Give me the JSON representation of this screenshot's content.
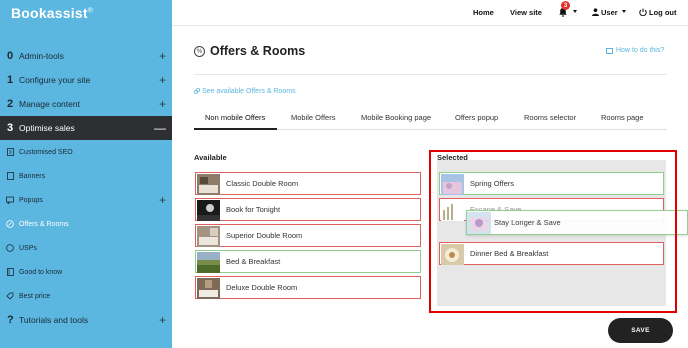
{
  "sidebar": {
    "logo": "Bookassist",
    "logo_mark": "®",
    "items": [
      {
        "num": "0",
        "label": "Admin-tools",
        "toggle": "+"
      },
      {
        "num": "1",
        "label": "Configure your site",
        "toggle": "+"
      },
      {
        "num": "2",
        "label": "Manage content",
        "toggle": "+"
      },
      {
        "num": "3",
        "label": "Optimise sales",
        "toggle": "—"
      }
    ],
    "subitems": [
      {
        "label": "Customised SEO",
        "icon": "document-icon"
      },
      {
        "label": "Banners",
        "icon": "banner-icon"
      },
      {
        "label": "Popups",
        "icon": "popup-icon",
        "toggle": "+"
      },
      {
        "label": "Offers & Rooms",
        "icon": "percent-icon"
      },
      {
        "label": "USPs",
        "icon": "usp-icon"
      },
      {
        "label": "Good to know",
        "icon": "book-icon"
      },
      {
        "label": "Best price",
        "icon": "price-icon"
      }
    ],
    "last_item": {
      "num": "?",
      "label": "Tutorials and tools",
      "toggle": "+"
    }
  },
  "topbar": {
    "home": "Home",
    "view_site": "View site",
    "notifications": "3",
    "user": "User",
    "logout": "Log out"
  },
  "page": {
    "title": "Offers & Rooms",
    "howto": "How to do this?",
    "see_link": "See available Offers & Rooms"
  },
  "tabs": [
    "Non mobile Offers",
    "Mobile Offers",
    "Mobile Booking page",
    "Offers popup",
    "Rooms selector",
    "Rooms page"
  ],
  "available_label": "Available",
  "selected_label": "Selected",
  "available": [
    {
      "name": "Classic Double Room",
      "state": "red"
    },
    {
      "name": "Book for Tonight",
      "state": "red"
    },
    {
      "name": "Superior Double Room",
      "state": "red"
    },
    {
      "name": "Bed & Breakfast",
      "state": "green"
    },
    {
      "name": "Deluxe Double Room",
      "state": "red"
    }
  ],
  "selected": [
    {
      "name": "Spring Offers",
      "state": "green"
    },
    {
      "name": "Dinner Bed & Breakfast",
      "state": "red"
    }
  ],
  "dragging": {
    "name": "Stay Longer & Save",
    "partially_hidden": "Escape & Save"
  },
  "save_label": "SAVE",
  "colors": {
    "sidebar": "#5bb6e0",
    "accent": "#5bb6e0",
    "active_nav": "#2d2f33",
    "badge": "#e0312c",
    "highlight_frame": "#e00000"
  }
}
